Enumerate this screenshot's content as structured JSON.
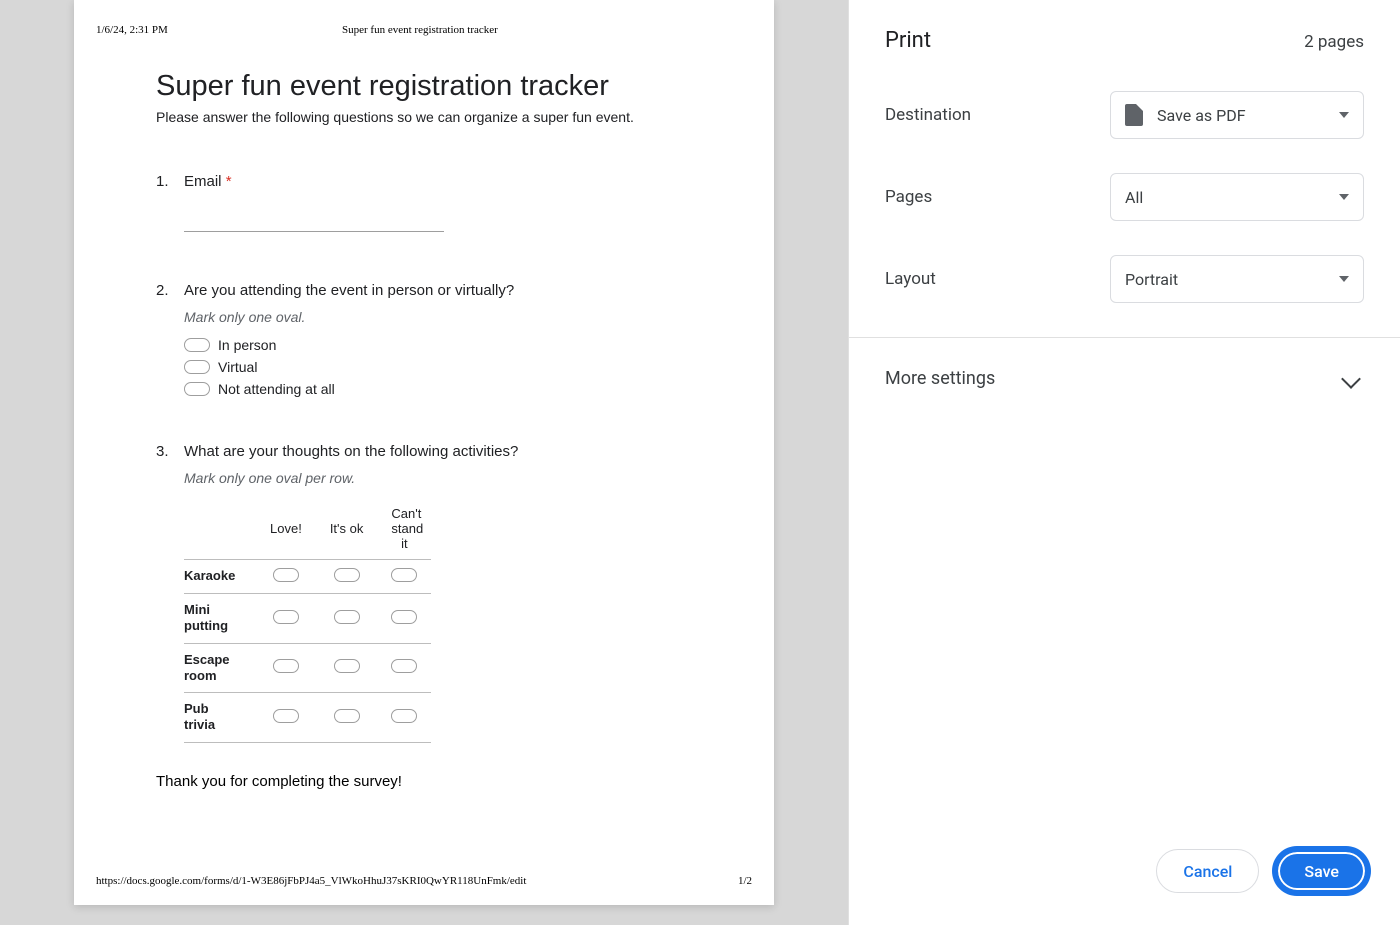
{
  "preview": {
    "timestamp": "1/6/24, 2:31 PM",
    "header_title": "Super fun event registration tracker",
    "form_title": "Super fun event registration tracker",
    "form_desc": "Please answer the following questions so we can organize a super fun event.",
    "q1": {
      "num": "1.",
      "text": "Email",
      "required_star": "*"
    },
    "q2": {
      "num": "2.",
      "text": "Are you attending the event in person or virtually?",
      "hint": "Mark only one oval.",
      "options": [
        "In person",
        "Virtual",
        "Not attending at all"
      ]
    },
    "q3": {
      "num": "3.",
      "text": "What are your thoughts on the following activities?",
      "hint": "Mark only one oval per row.",
      "cols": [
        "Love!",
        "It's ok",
        "Can't stand it"
      ],
      "rows": [
        "Karaoke",
        "Mini putting",
        "Escape room",
        "Pub trivia"
      ]
    },
    "thanks": "Thank you for completing the survey!",
    "footer_url": "https://docs.google.com/forms/d/1-W3E86jFbPJ4a5_VlWkoHhuJ37sKRI0QwYR118UnFmk/edit",
    "footer_page": "1/2"
  },
  "panel": {
    "title": "Print",
    "page_count": "2 pages",
    "destination_label": "Destination",
    "destination_value": "Save as PDF",
    "pages_label": "Pages",
    "pages_value": "All",
    "layout_label": "Layout",
    "layout_value": "Portrait",
    "more_settings": "More settings",
    "cancel": "Cancel",
    "save": "Save"
  }
}
